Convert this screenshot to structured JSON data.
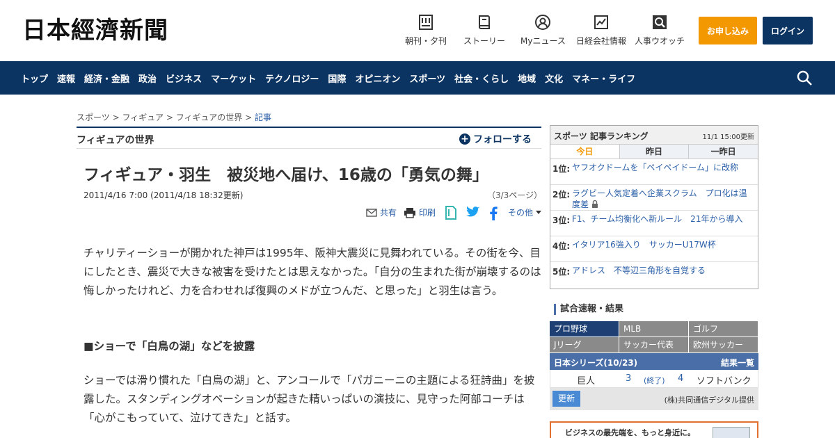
{
  "header": {
    "logo": "日本經濟新聞",
    "nav": [
      {
        "label": "朝刊・夕刊",
        "icon": "newspaper-icon"
      },
      {
        "label": "ストーリー",
        "icon": "book-icon"
      },
      {
        "label": "Myニュース",
        "icon": "user-circle-icon"
      },
      {
        "label": "日経会社情報",
        "icon": "chart-line-icon"
      },
      {
        "label": "人事ウオッチ",
        "icon": "magnifier-icon"
      }
    ],
    "apply_label": "お申し込み",
    "login_label": "ログイン"
  },
  "global_nav": [
    "トップ",
    "速報",
    "経済・金融",
    "政治",
    "ビジネス",
    "マーケット",
    "テクノロジー",
    "国際",
    "オピニオン",
    "スポーツ",
    "社会・くらし",
    "地域",
    "文化",
    "マネー・ライフ"
  ],
  "breadcrumb": {
    "items": [
      "スポーツ",
      "フィギュア",
      "フィギュアの世界"
    ],
    "separator": ">",
    "current": "記事"
  },
  "section": {
    "title": "フィギュアの世界",
    "follow_label": "フォローする"
  },
  "article": {
    "headline": "フィギュア・羽生　被災地へ届け、16歳の「勇気の舞」",
    "dateline": "2011/4/16 7:00 (2011/4/18 18:32更新)",
    "page_info": "（3/3ページ）",
    "share": {
      "share": "共有",
      "print": "印刷",
      "more": "その他"
    },
    "paragraph1": "チャリティーショーが開かれた神戸は1995年、阪神大震災に見舞われている。その街を今、目にしたとき、震災で大きな被害を受けたとは思えなかった。「自分の生まれた街が崩壊するのは悔しかったけれど、力を合わせれば復興のメドが立つんだ、と思った」と羽生は言う。",
    "subheading": "■ショーで「白鳥の湖」などを披露",
    "paragraph2": "ショーでは滑り慣れた「白鳥の湖」と、アンコールで「パガニーニの主題による狂詩曲」を披露した。スタンディングオベーションが起きた精いっぱいの演技に、見守った阿部コーチは「心がこもっていて、泣けてきた」と話す。"
  },
  "ranking": {
    "title": "スポーツ 記事ランキング",
    "updated": "11/1 15:00更新",
    "tabs": [
      "今日",
      "昨日",
      "一昨日"
    ],
    "items": [
      {
        "rank": "1位:",
        "text": "ヤフオクドームを「ペイペイドーム」に改称"
      },
      {
        "rank": "2位:",
        "text": "ラグビー人気定着へ企業スクラム　プロ化は温度差"
      },
      {
        "rank": "3位:",
        "text": "F1、チーム均衡化へ新ルール　21年から導入"
      },
      {
        "rank": "4位:",
        "text": "イタリア16強入り　サッカーU17W杯"
      },
      {
        "rank": "5位:",
        "text": "アドレス　不等辺三角形を自覚する"
      }
    ]
  },
  "scores": {
    "title": "試合速報・結果",
    "categories": [
      "プロ野球",
      "MLB",
      "ゴルフ",
      "Jリーグ",
      "サッカー代表",
      "欧州サッカー"
    ],
    "series_title": "日本シリーズ(10/23)",
    "results_link": "結果一覧",
    "game": {
      "home": "巨人",
      "home_score": "3",
      "status": "(終了)",
      "away_score": "4",
      "away": "ソフトバンク"
    },
    "refresh_label": "更新",
    "provider": "(株)共同通信デジタル提供"
  },
  "ad": {
    "text": "ビジネスの最先端を、もっと身近に。"
  }
}
